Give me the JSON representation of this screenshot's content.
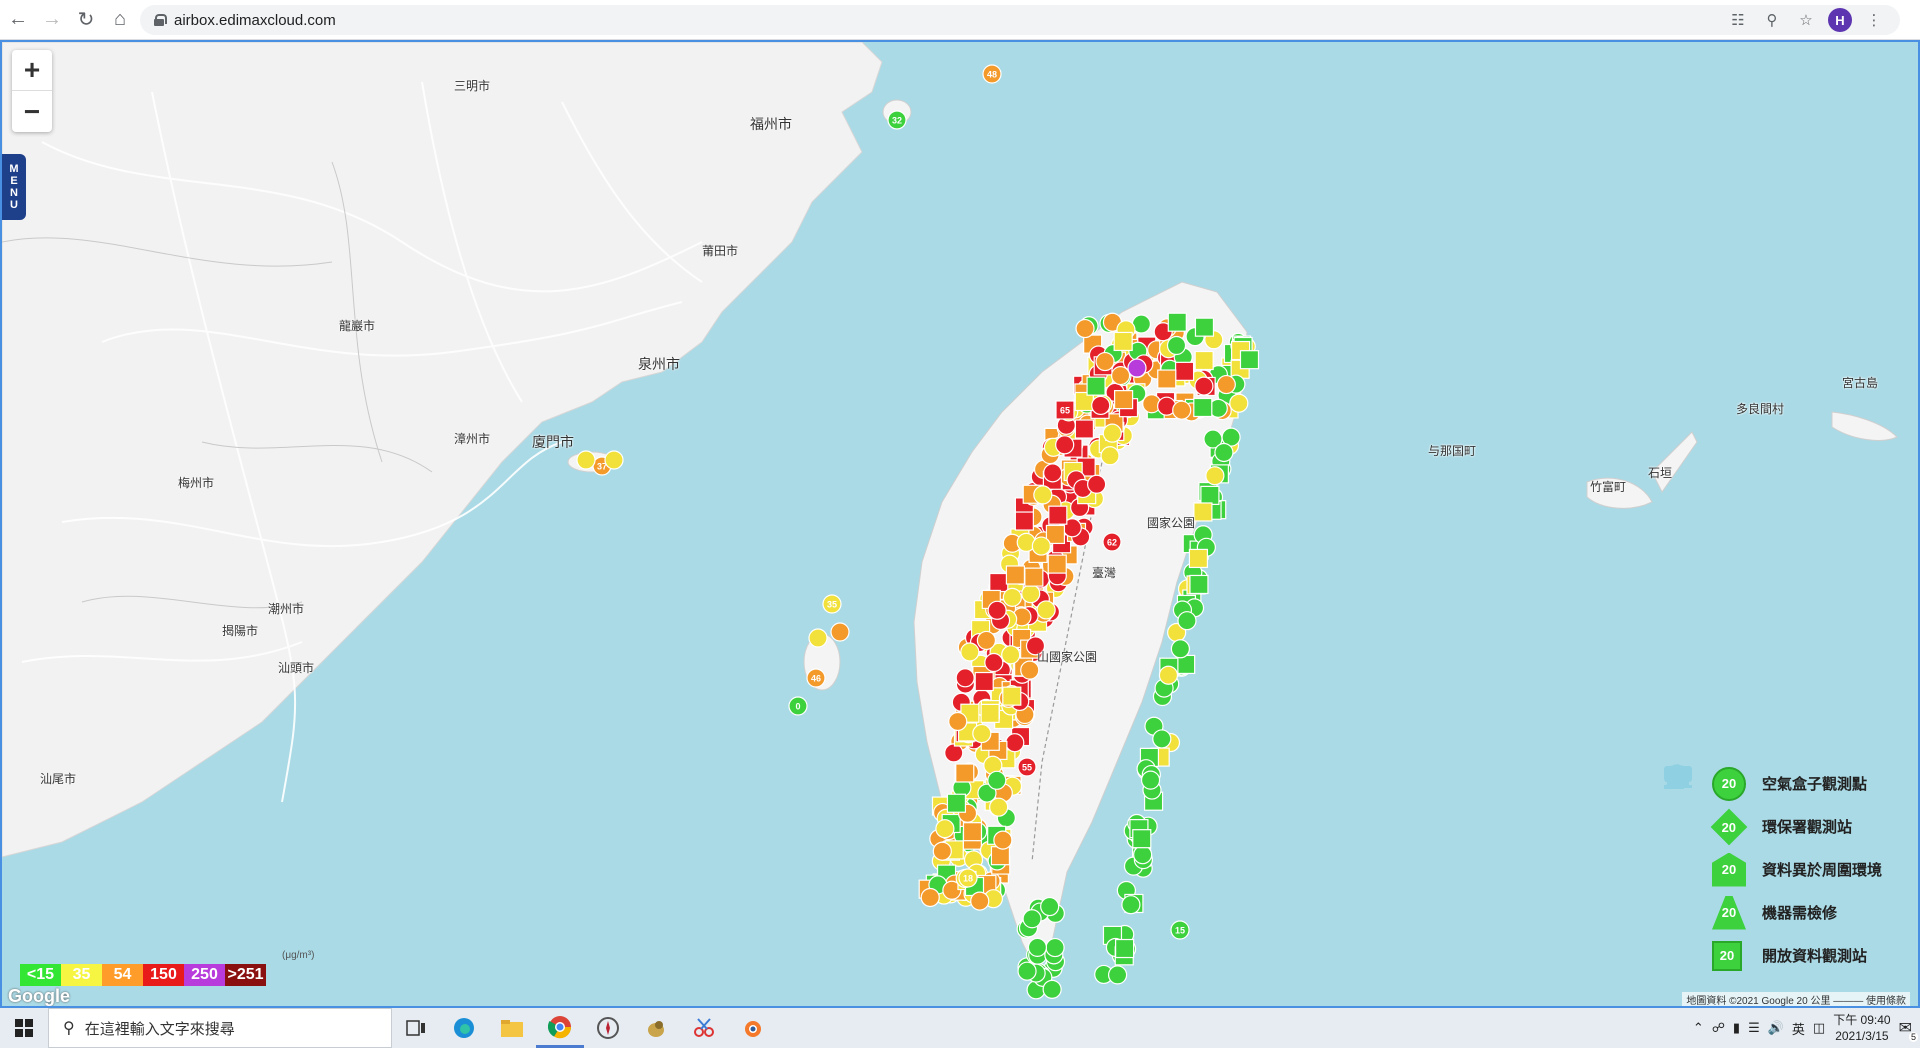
{
  "browser": {
    "url": "airbox.edimaxcloud.com",
    "profile_initial": "H"
  },
  "map": {
    "zoom_in": "+",
    "zoom_out": "−",
    "menu_label": [
      "M",
      "E",
      "N",
      "U"
    ],
    "places": [
      {
        "id": "sanming",
        "label": "三明市"
      },
      {
        "id": "fuzhou",
        "label": "福州市"
      },
      {
        "id": "putian",
        "label": "莆田市"
      },
      {
        "id": "longyan",
        "label": "龍巖市"
      },
      {
        "id": "quanzhou",
        "label": "泉州市"
      },
      {
        "id": "zhangzhou",
        "label": "漳州市"
      },
      {
        "id": "xiamen",
        "label": "廈門市"
      },
      {
        "id": "meizhou",
        "label": "梅州市"
      },
      {
        "id": "chaozhou",
        "label": "潮州市"
      },
      {
        "id": "jieyang",
        "label": "揭陽市"
      },
      {
        "id": "shantou",
        "label": "汕頭市"
      },
      {
        "id": "shanwei",
        "label": "汕尾市"
      },
      {
        "id": "miyako",
        "label": "宮古島"
      },
      {
        "id": "tarama",
        "label": "多良間村"
      },
      {
        "id": "yonaguni",
        "label": "与那国町"
      },
      {
        "id": "taketomi",
        "label": "竹富町"
      },
      {
        "id": "ishigaki",
        "label": "石垣"
      }
    ],
    "map_badges": {
      "park1": "國家公園",
      "park2": "山國家公園",
      "taichung": "臺灣"
    },
    "attribution": "地圖資料 ©2021 Google   20 公里 ———   使用條款",
    "google_logo": "Google"
  },
  "aqi_scale": {
    "unit": "(μg/m³)",
    "segments": [
      {
        "label": "<15",
        "color": "#33e633"
      },
      {
        "label": "35",
        "color": "#f5f542"
      },
      {
        "label": "54",
        "color": "#ff9c2a"
      },
      {
        "label": "150",
        "color": "#e81a1a"
      },
      {
        "label": "250",
        "color": "#b83cdb"
      },
      {
        "label": ">251",
        "color": "#8a1010"
      }
    ]
  },
  "legend": {
    "sample_value": "20",
    "items": [
      {
        "label": "空氣盒子觀測點",
        "shape": "circle"
      },
      {
        "label": "環保署觀測站",
        "shape": "diamond"
      },
      {
        "label": "資料異於周圍環境",
        "shape": "house"
      },
      {
        "label": "機器需檢修",
        "shape": "cone"
      },
      {
        "label": "開放資料觀測站",
        "shape": "square"
      }
    ]
  },
  "stations": {
    "colors": {
      "green": "#3ed13e",
      "yellow": "#f2e13a",
      "orange": "#f39a2b",
      "red": "#e4212b",
      "purple": "#b83cdb"
    },
    "visible_values": {
      "lienchiang": "32",
      "matsu": "48",
      "kinmen": "37",
      "penghu_a": "35",
      "penghu_b": "46",
      "penghu_c": "0",
      "green_island": "15",
      "orchid": "18",
      "kaohsiung_red": "55",
      "nantou_red": "62",
      "taoyuan_red": "65"
    }
  },
  "taskbar": {
    "search_placeholder": "在這裡輸入文字來搜尋",
    "ime": "英",
    "time": "下午 09:40",
    "date": "2021/3/15",
    "notification_count": "5"
  }
}
